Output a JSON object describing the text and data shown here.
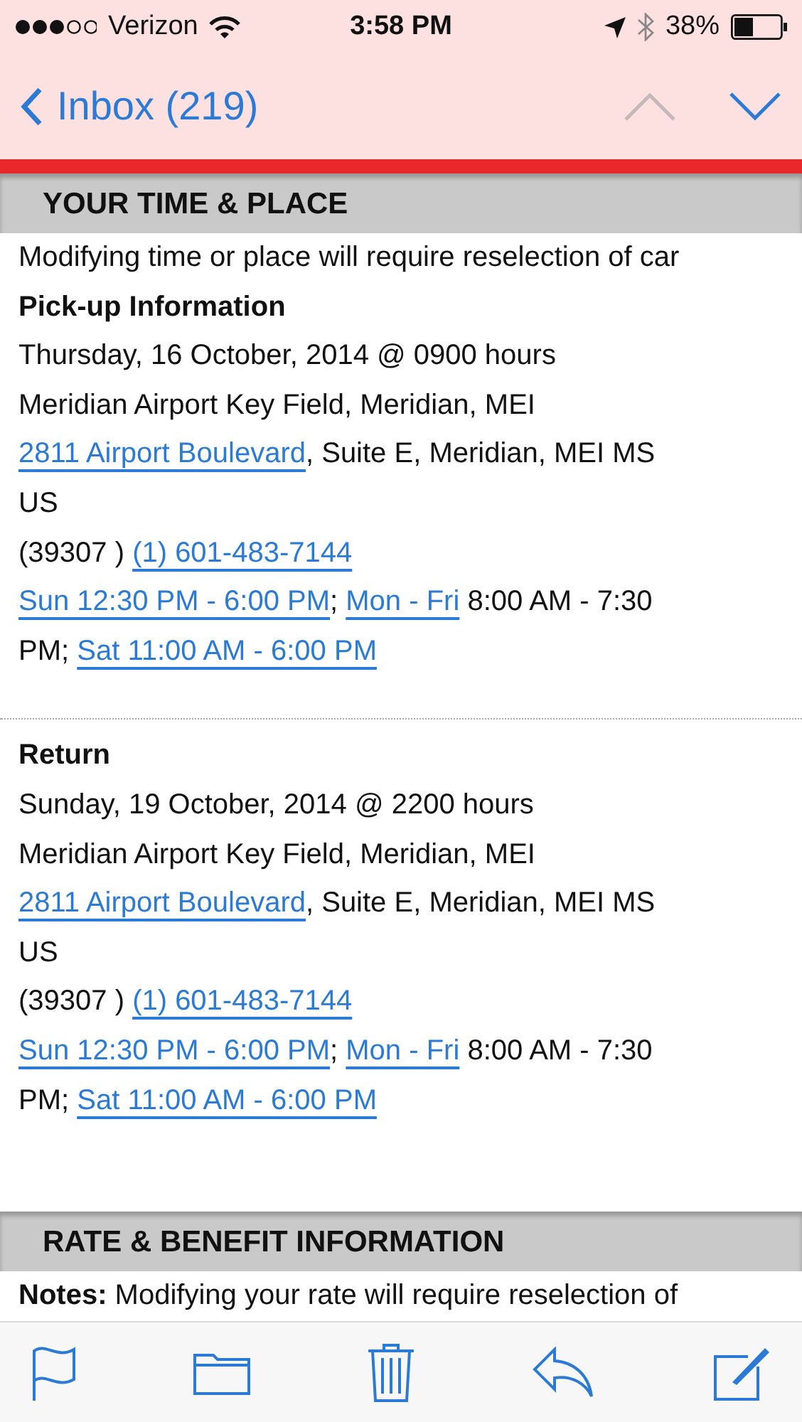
{
  "status_bar": {
    "carrier": "Verizon",
    "time": "3:58 PM",
    "battery": "38%"
  },
  "nav": {
    "back_label": "Inbox (219)",
    "previous_enabled": false,
    "next_enabled": true
  },
  "sections": [
    {
      "title": "YOUR TIME & PLACE",
      "blocks": [
        {
          "kind": "line",
          "segments": [
            {
              "text": "Modifying time or place will require reselection of car",
              "link": false
            }
          ]
        },
        {
          "kind": "heading",
          "segments": [
            {
              "text": "Pick-up Information",
              "link": false
            }
          ]
        },
        {
          "kind": "line",
          "segments": [
            {
              "text": "Thursday, 16 October, 2014 @ 0900 hours",
              "link": false
            }
          ]
        },
        {
          "kind": "line",
          "segments": [
            {
              "text": "Meridian Airport Key Field, Meridian, MEI",
              "link": false
            }
          ]
        },
        {
          "kind": "line",
          "segments": [
            {
              "text": "2811 Airport Boulevard",
              "link": true
            },
            {
              "text": ", Suite E, Meridian, MEI MS",
              "link": false
            }
          ]
        },
        {
          "kind": "line",
          "segments": [
            {
              "text": "US",
              "link": false
            }
          ]
        },
        {
          "kind": "line",
          "segments": [
            {
              "text": "(39307 )  ",
              "link": false
            },
            {
              "text": "(1) 601-483-7144",
              "link": true
            }
          ]
        },
        {
          "kind": "line",
          "segments": [
            {
              "text": "Sun 12:30 PM - 6:00 PM",
              "link": true
            },
            {
              "text": "; ",
              "link": false
            },
            {
              "text": "Mon - Fri",
              "link": true
            },
            {
              "text": " 8:00 AM - 7:30",
              "link": false
            }
          ]
        },
        {
          "kind": "line",
          "segments": [
            {
              "text": "PM; ",
              "link": false
            },
            {
              "text": "Sat 11:00 AM - 6:00 PM",
              "link": true
            }
          ]
        },
        {
          "kind": "divider"
        },
        {
          "kind": "heading",
          "segments": [
            {
              "text": "Return",
              "link": false
            }
          ]
        },
        {
          "kind": "line",
          "segments": [
            {
              "text": "Sunday, 19 October, 2014 @ 2200 hours",
              "link": false
            }
          ]
        },
        {
          "kind": "line",
          "segments": [
            {
              "text": "Meridian Airport Key Field, Meridian, MEI",
              "link": false
            }
          ]
        },
        {
          "kind": "line",
          "segments": [
            {
              "text": "2811 Airport Boulevard",
              "link": true
            },
            {
              "text": ", Suite E, Meridian, MEI MS",
              "link": false
            }
          ]
        },
        {
          "kind": "line",
          "segments": [
            {
              "text": "US",
              "link": false
            }
          ]
        },
        {
          "kind": "line",
          "segments": [
            {
              "text": "(39307 )  ",
              "link": false
            },
            {
              "text": "(1) 601-483-7144",
              "link": true
            }
          ]
        },
        {
          "kind": "line",
          "segments": [
            {
              "text": "Sun 12:30 PM - 6:00 PM",
              "link": true
            },
            {
              "text": "; ",
              "link": false
            },
            {
              "text": "Mon - Fri",
              "link": true
            },
            {
              "text": " 8:00 AM - 7:30",
              "link": false
            }
          ]
        },
        {
          "kind": "line",
          "segments": [
            {
              "text": "PM; ",
              "link": false
            },
            {
              "text": "Sat 11:00 AM - 6:00 PM",
              "link": true
            }
          ]
        }
      ]
    },
    {
      "title": "RATE & BENEFIT INFORMATION",
      "blocks": [
        {
          "kind": "line",
          "segments": [
            {
              "text": "**Notes:** Modifying your rate will require reselection of",
              "link": false
            }
          ]
        }
      ]
    }
  ]
}
